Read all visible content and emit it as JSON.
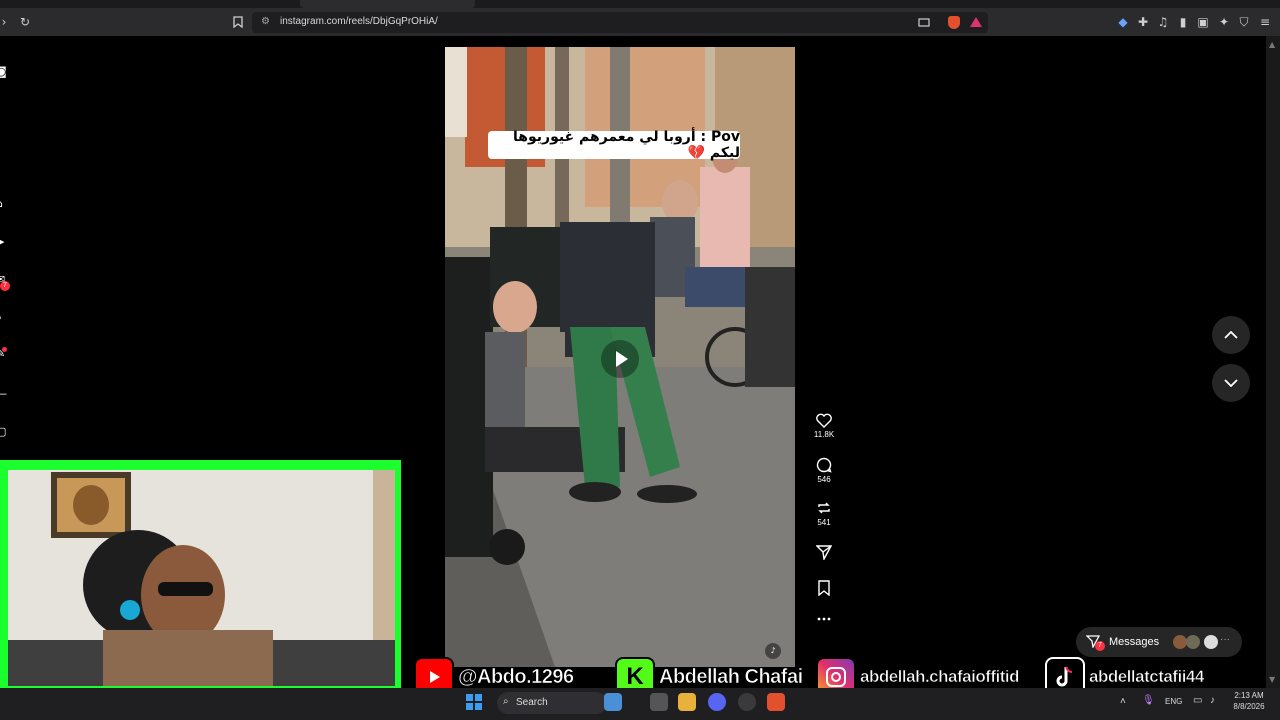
{
  "browser": {
    "url": "instagram.com/reels/DbjGqPrOHiA/"
  },
  "sidebar": {
    "notifications_badge": "7"
  },
  "reel": {
    "caption_text": "Pov : أروبا لي معمرهم غيوريوها ليكم 💔",
    "actions": {
      "likes": "11.8K",
      "comments": "546",
      "reposts": "541"
    }
  },
  "messages": {
    "label": "Messages",
    "badge": "7"
  },
  "social_banner": {
    "youtube": "@Abdo.1296",
    "kick": "Abdellah Chafai",
    "instagram": "abdellah.chafaioffitid",
    "tiktok": "abdellatctafii44"
  },
  "taskbar": {
    "search_label": "Search",
    "language": "ENG",
    "time": "2:13 AM",
    "date": "8/8/2026"
  },
  "colors": {
    "accent_green": "#1cff2f",
    "instagram_red": "#ff3040",
    "youtube_red": "#ff0000",
    "kick_green": "#53fc18"
  }
}
